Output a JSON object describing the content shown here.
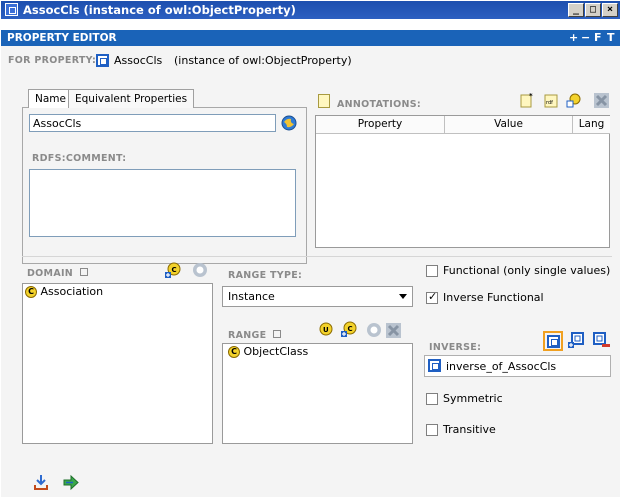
{
  "window": {
    "title": "AssocCls  (instance of owl:ObjectProperty)",
    "min_glyph": "_",
    "max_glyph": "□",
    "close_glyph": "×"
  },
  "editor": {
    "header": "PROPERTY EDITOR",
    "controls": [
      "+",
      "−",
      "F",
      "T"
    ],
    "for_label": "FOR PROPERTY:",
    "property_name": "AssocCls",
    "instance_of": "(instance of owl:ObjectProperty)"
  },
  "tabs": [
    {
      "label": "Name"
    },
    {
      "label": "Equivalent Properties"
    }
  ],
  "name_field": {
    "value": "AssocCls"
  },
  "comment": {
    "label": "RDFS:COMMENT:",
    "value": ""
  },
  "annotations": {
    "label": "ANNOTATIONS:",
    "columns": [
      "Property",
      "Value",
      "Lang"
    ]
  },
  "domain": {
    "label": "DOMAIN",
    "items": [
      {
        "badge": "C",
        "label": "Association"
      }
    ]
  },
  "range_type": {
    "label": "RANGE TYPE:",
    "selected": "Instance"
  },
  "range": {
    "label": "RANGE",
    "items": [
      {
        "badge": "C",
        "label": "ObjectClass"
      }
    ]
  },
  "characteristics": {
    "functional": {
      "label": "Functional (only single values)",
      "checked": false
    },
    "inverse_functional": {
      "label": "Inverse Functional",
      "checked": true
    },
    "symmetric": {
      "label": "Symmetric",
      "checked": false
    },
    "transitive": {
      "label": "Transitive",
      "checked": false
    }
  },
  "inverse": {
    "label": "INVERSE:",
    "value": "inverse_of_AssocCls"
  },
  "icons": {
    "title": "property-icon",
    "add_annotation": "add-annotation-icon",
    "add_domain": "add-class-icon",
    "remove": "remove-icon",
    "footer": [
      "download-icon",
      "forward-arrow-icon"
    ]
  },
  "colors": {
    "titlebar": "#1d4fae",
    "header": "#1a63b8",
    "class_badge": "#f3d22b",
    "property_blue": "#1f5fc3"
  }
}
